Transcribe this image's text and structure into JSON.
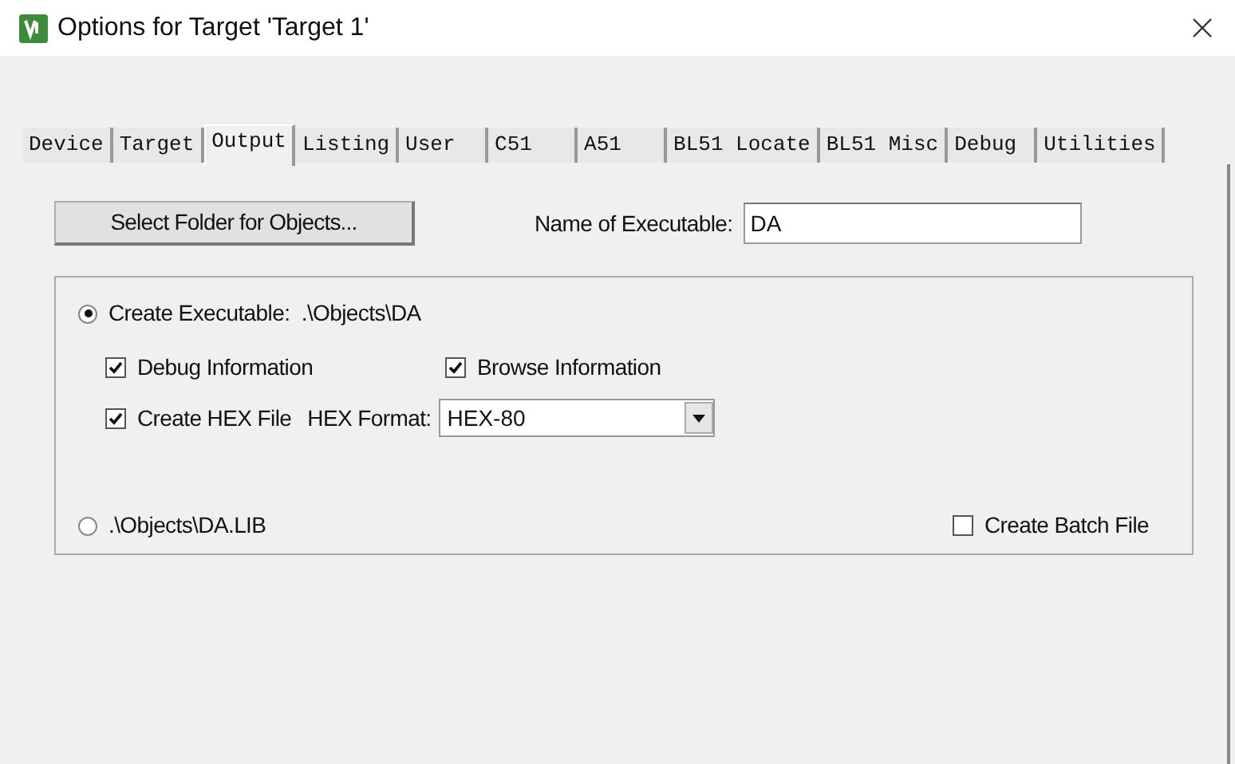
{
  "window": {
    "title": "Options for Target 'Target 1'"
  },
  "tabs": [
    {
      "label": "Device",
      "selected": false
    },
    {
      "label": "Target",
      "selected": false
    },
    {
      "label": "Output",
      "selected": true
    },
    {
      "label": "Listing",
      "selected": false
    },
    {
      "label": "User",
      "selected": false
    },
    {
      "label": "C51",
      "selected": false
    },
    {
      "label": "A51",
      "selected": false
    },
    {
      "label": "BL51 Locate",
      "selected": false
    },
    {
      "label": "BL51 Misc",
      "selected": false
    },
    {
      "label": "Debug",
      "selected": false
    },
    {
      "label": "Utilities",
      "selected": false
    }
  ],
  "select_folder_button": "Select Folder for Objects...",
  "executable_name": {
    "label": "Name of Executable:",
    "value": "DA"
  },
  "output_group": {
    "create_executable": {
      "label": "Create Executable:  .\\Objects\\DA",
      "selected": true
    },
    "debug_information": {
      "label": "Debug Information",
      "checked": true
    },
    "browse_information": {
      "label": "Browse Information",
      "checked": true
    },
    "create_hex_file": {
      "label": "Create HEX File",
      "checked": true
    },
    "hex_format": {
      "label": "HEX Format:",
      "value": "HEX-80"
    },
    "create_library": {
      "label": ".\\Objects\\DA.LIB",
      "selected": false
    },
    "create_batch_file": {
      "label": "Create Batch File",
      "checked": false
    }
  }
}
